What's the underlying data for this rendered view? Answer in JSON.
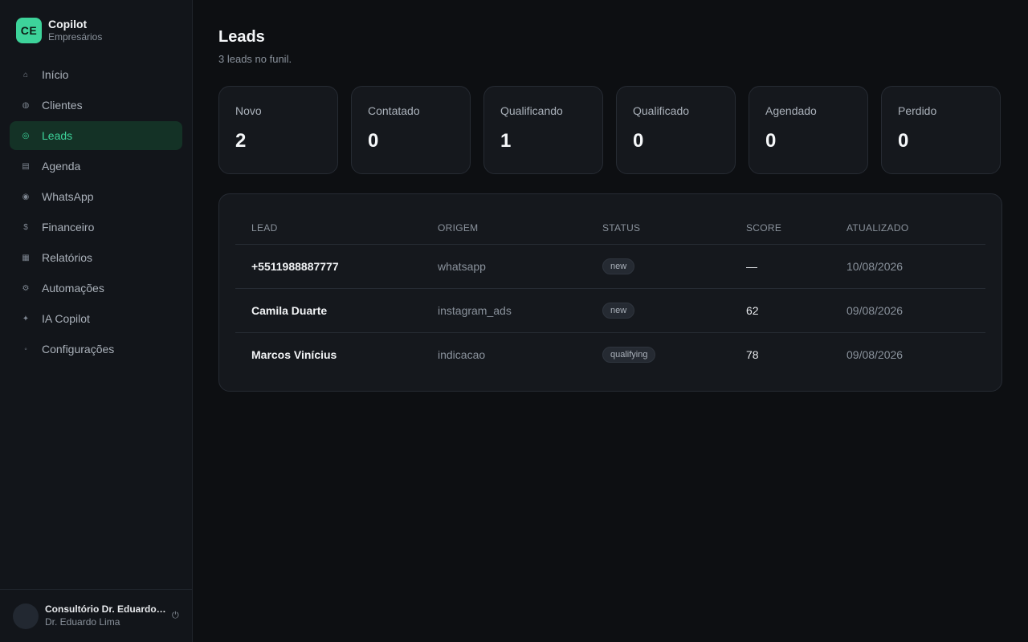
{
  "brand": {
    "initials": "CE",
    "name": "Copilot",
    "subtitle": "Empresários"
  },
  "sidebar": {
    "items": [
      {
        "icon": "⌂",
        "label": "Início",
        "active": false
      },
      {
        "icon": "◍",
        "label": "Clientes",
        "active": false
      },
      {
        "icon": "◎",
        "label": "Leads",
        "active": true
      },
      {
        "icon": "▤",
        "label": "Agenda",
        "active": false
      },
      {
        "icon": "◉",
        "label": "WhatsApp",
        "active": false
      },
      {
        "icon": "$",
        "label": "Financeiro",
        "active": false
      },
      {
        "icon": "▦",
        "label": "Relatórios",
        "active": false
      },
      {
        "icon": "⚙",
        "label": "Automações",
        "active": false
      },
      {
        "icon": "✦",
        "label": "IA Copilot",
        "active": false
      },
      {
        "icon": "◦",
        "label": "Configurações",
        "active": false
      }
    ]
  },
  "user": {
    "org": "Consultório Dr. Eduardo…",
    "name": "Dr. Eduardo Lima",
    "logout_icon": "⏻"
  },
  "page": {
    "title": "Leads",
    "subtitle": "3 leads no funil."
  },
  "stats": [
    {
      "label": "Novo",
      "value": "2"
    },
    {
      "label": "Contatado",
      "value": "0"
    },
    {
      "label": "Qualificando",
      "value": "1"
    },
    {
      "label": "Qualificado",
      "value": "0"
    },
    {
      "label": "Agendado",
      "value": "0"
    },
    {
      "label": "Perdido",
      "value": "0"
    }
  ],
  "table": {
    "columns": [
      "LEAD",
      "ORIGEM",
      "STATUS",
      "SCORE",
      "ATUALIZADO"
    ],
    "rows": [
      {
        "lead": "+5511988887777",
        "origem": "whatsapp",
        "status": "new",
        "score": "—",
        "atualizado": "10/08/2026"
      },
      {
        "lead": "Camila Duarte",
        "origem": "instagram_ads",
        "status": "new",
        "score": "62",
        "atualizado": "09/08/2026"
      },
      {
        "lead": "Marcos Vinícius",
        "origem": "indicacao",
        "status": "qualifying",
        "score": "78",
        "atualizado": "09/08/2026"
      }
    ]
  },
  "colors": {
    "accent": "#3dd39a",
    "background": "#0d0f12",
    "sidebar": "#12151a",
    "card": "#15181d"
  }
}
